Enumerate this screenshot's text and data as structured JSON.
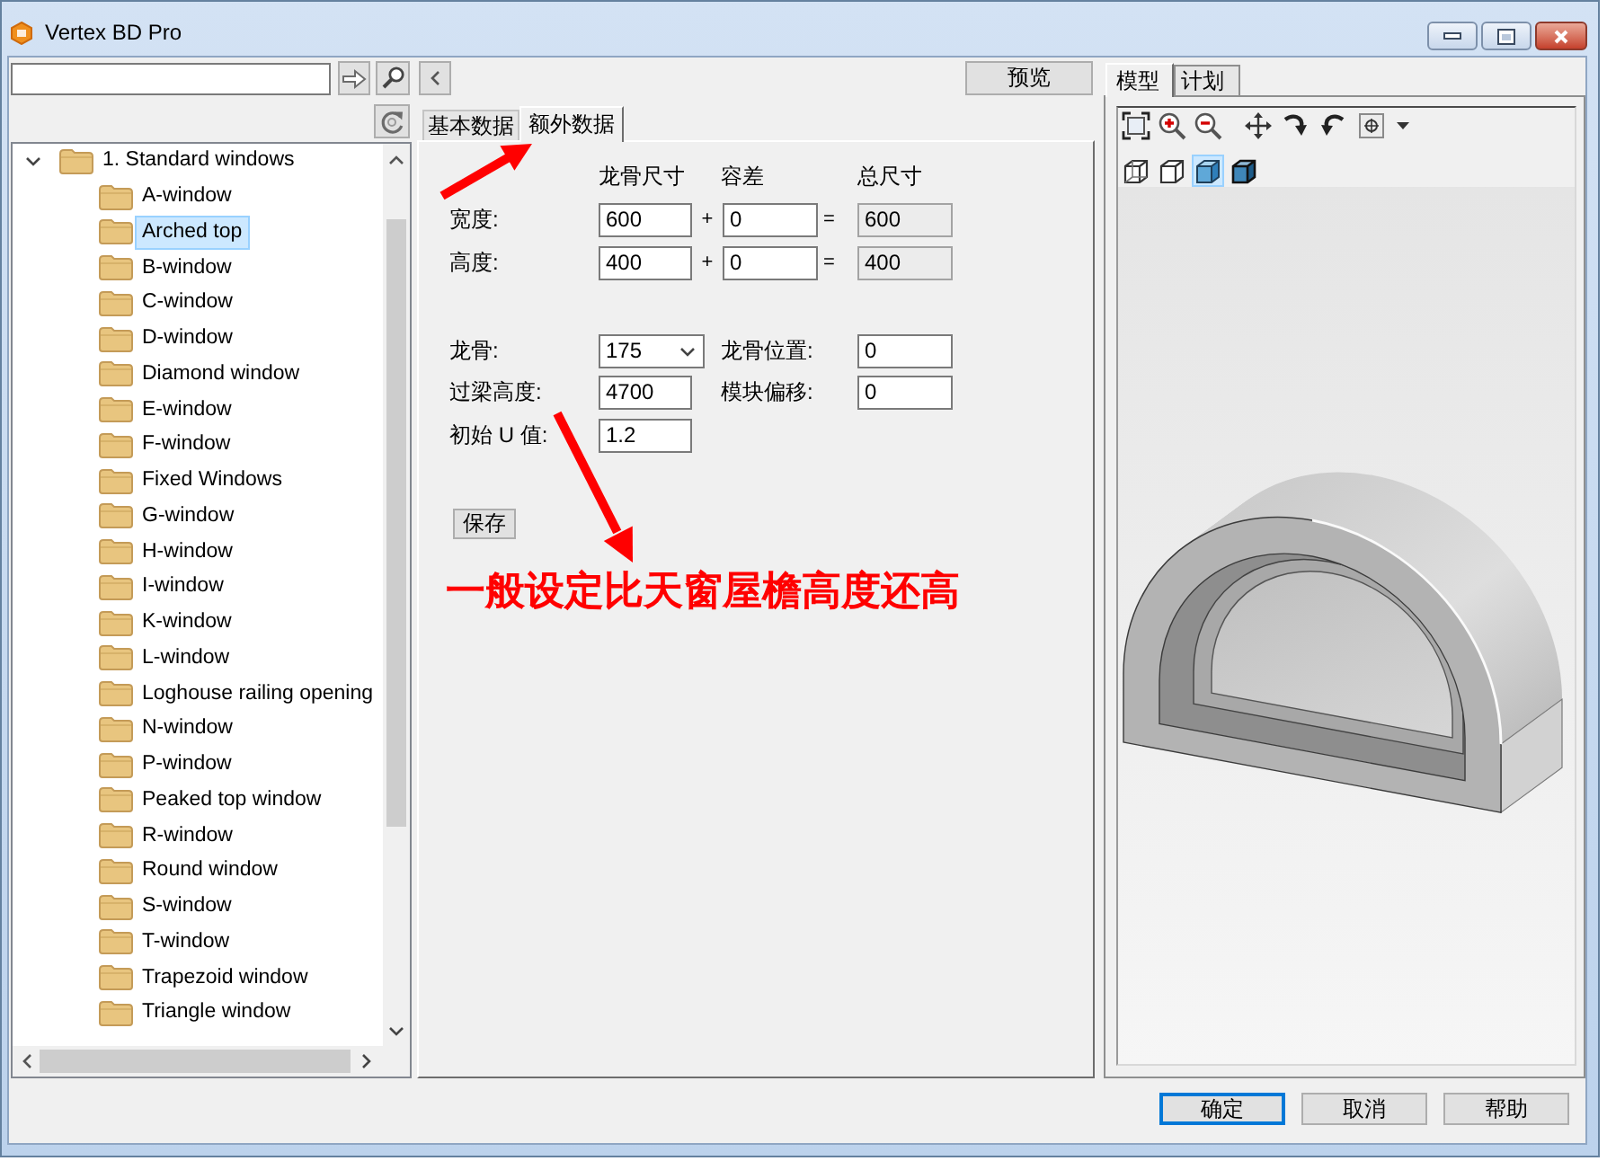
{
  "window": {
    "title": "Vertex BD Pro"
  },
  "tree": {
    "items": [
      {
        "label": "1. Standard windows",
        "expanded": true,
        "selected": false,
        "children": [
          {
            "label": "A-window",
            "selected": false
          },
          {
            "label": "Arched top",
            "selected": true
          },
          {
            "label": "B-window",
            "selected": false
          },
          {
            "label": "C-window",
            "selected": false
          },
          {
            "label": "D-window",
            "selected": false
          },
          {
            "label": "Diamond window",
            "selected": false
          },
          {
            "label": "E-window",
            "selected": false
          },
          {
            "label": "F-window",
            "selected": false
          },
          {
            "label": "Fixed Windows",
            "selected": false
          },
          {
            "label": "G-window",
            "selected": false
          },
          {
            "label": "H-window",
            "selected": false
          },
          {
            "label": "I-window",
            "selected": false
          },
          {
            "label": "K-window",
            "selected": false
          },
          {
            "label": "L-window",
            "selected": false
          },
          {
            "label": "Loghouse railing opening",
            "selected": false
          },
          {
            "label": "N-window",
            "selected": false
          },
          {
            "label": "P-window",
            "selected": false
          },
          {
            "label": "Peaked top window",
            "selected": false
          },
          {
            "label": "R-window",
            "selected": false
          },
          {
            "label": "Round window",
            "selected": false
          },
          {
            "label": "S-window",
            "selected": false
          },
          {
            "label": "T-window",
            "selected": false
          },
          {
            "label": "Trapezoid window",
            "selected": false
          },
          {
            "label": "Triangle window",
            "selected": false
          }
        ]
      }
    ]
  },
  "preview_button": {
    "label": "预览"
  },
  "tabs": [
    {
      "label": "基本数据",
      "selected": false
    },
    {
      "label": "额外数据",
      "selected": true
    }
  ],
  "form": {
    "column_headers": [
      "龙骨尺寸",
      "容差",
      "总尺寸"
    ],
    "size_rows": [
      {
        "label": "宽度:",
        "frame_size": "600",
        "plus": "+",
        "tolerance": "0",
        "equals": "=",
        "total": "600"
      },
      {
        "label": "高度:",
        "frame_size": "400",
        "plus": "+",
        "tolerance": "0",
        "equals": "=",
        "total": "400"
      }
    ],
    "detail_rows": [
      [
        {
          "label": "龙骨:",
          "kind": "dropdown",
          "value": "175"
        },
        {
          "label": "龙骨位置:",
          "kind": "input",
          "value": "0"
        }
      ],
      [
        {
          "label": "过梁高度:",
          "kind": "input",
          "value": "4700"
        },
        {
          "label": "模块偏移:",
          "kind": "input",
          "value": "0"
        }
      ],
      [
        {
          "label": "初始 U 值:",
          "kind": "input",
          "value": "1.2"
        }
      ]
    ],
    "save_button": {
      "label": "保存"
    }
  },
  "view_tabs": [
    {
      "label": "模型",
      "selected": true
    },
    {
      "label": "计划",
      "selected": false
    }
  ],
  "view_toolbar": {
    "tools": [
      {
        "kind": "zoom_extents"
      },
      {
        "kind": "zoom_in"
      },
      {
        "kind": "zoom_out"
      },
      {
        "kind": "pan"
      },
      {
        "kind": "rotate_right"
      },
      {
        "kind": "rotate_left"
      },
      {
        "kind": "view_target"
      },
      {
        "kind": "dropdown_caret"
      }
    ],
    "view_modes": [
      {
        "kind": "wireframe",
        "selected": false
      },
      {
        "kind": "hidden_line",
        "selected": false
      },
      {
        "kind": "shaded",
        "selected": true
      },
      {
        "kind": "shaded_edges",
        "selected": false
      }
    ]
  },
  "dialog_buttons": [
    {
      "label": "确定",
      "default": true
    },
    {
      "label": "取消",
      "default": false
    },
    {
      "label": "帮助",
      "default": false
    }
  ],
  "annotation": {
    "text": "一般设定比天窗屋檐高度还高"
  }
}
